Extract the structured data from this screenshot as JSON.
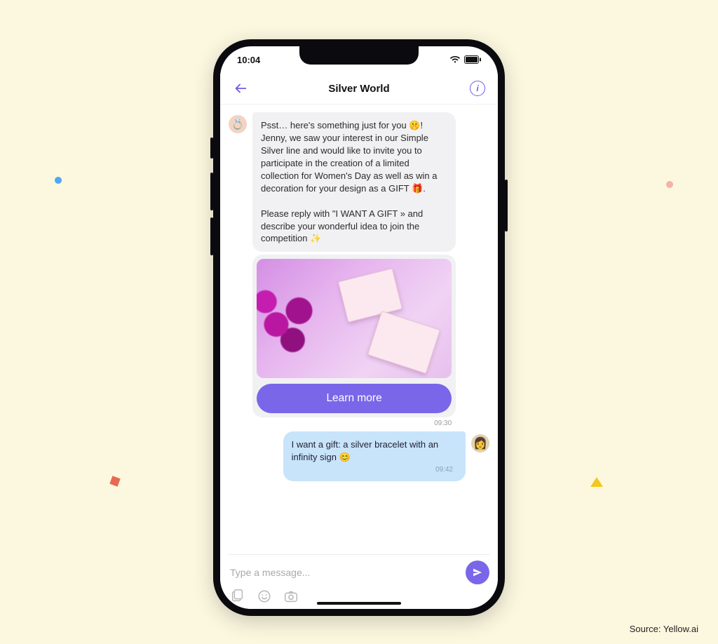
{
  "status": {
    "time": "10:04"
  },
  "header": {
    "title": "Silver World"
  },
  "bot_message": {
    "avatar_emoji": "💍",
    "text": "Psst… here's something just for you 🤫!\nJenny, we saw your interest in our Simple Silver line and would like to invite you to participate in the creation of a limited collection for Women's Day as well as win a decoration for your design as a GIFT 🎁.\n\nPlease reply with \"I WANT A GIFT » and describe your wonderful idea to join the competition ✨",
    "cta_label": "Learn more",
    "timestamp": "09:30"
  },
  "user_message": {
    "text": "I want a gift: a silver bracelet with an infinity sign 😊",
    "timestamp": "09:42",
    "avatar_emoji": "👩"
  },
  "composer": {
    "placeholder": "Type a message..."
  },
  "source_label": "Source: Yellow.ai"
}
